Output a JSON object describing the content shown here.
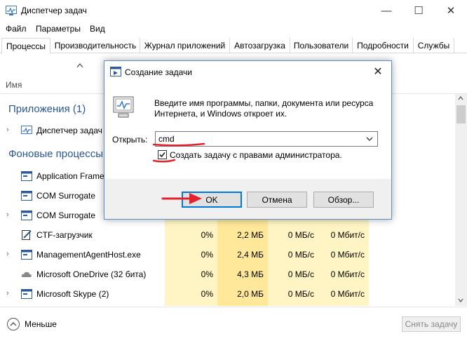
{
  "task_manager": {
    "title": "Диспетчер задач",
    "window_controls": {
      "minimize": "—",
      "maximize": "☐",
      "close": "✕"
    },
    "menu": [
      "Файл",
      "Параметры",
      "Вид"
    ],
    "tabs": [
      "Процессы",
      "Производительность",
      "Журнал приложений",
      "Автозагрузка",
      "Пользователи",
      "Подробности",
      "Службы"
    ],
    "active_tab": "Процессы",
    "column_name": "Имя",
    "sections": {
      "apps": "Приложения (1)",
      "background": "Фоновые процессы"
    },
    "rows": [
      {
        "expand": "›",
        "name": "Диспетчер задач",
        "cpu": "",
        "mem": "",
        "disk": "",
        "net": ""
      },
      {
        "expand": "",
        "name": "Application Frame",
        "cpu": "",
        "mem": "",
        "disk": "",
        "net": ""
      },
      {
        "expand": "",
        "name": "COM Surrogate",
        "cpu": "",
        "mem": "",
        "disk": "",
        "net": ""
      },
      {
        "expand": "›",
        "name": "COM Surrogate",
        "cpu": "",
        "mem": "",
        "disk": "",
        "net": ""
      },
      {
        "expand": "",
        "name": "CTF-загрузчик",
        "cpu": "0%",
        "mem": "2,2 МБ",
        "disk": "0 МБ/с",
        "net": "0 Мбит/с"
      },
      {
        "expand": "›",
        "name": "ManagementAgentHost.exe",
        "cpu": "0%",
        "mem": "2,4 МБ",
        "disk": "0 МБ/с",
        "net": "0 Мбит/с"
      },
      {
        "expand": "",
        "name": "Microsoft OneDrive (32 бита)",
        "cpu": "0%",
        "mem": "4,3 МБ",
        "disk": "0 МБ/с",
        "net": "0 Мбит/с"
      },
      {
        "expand": "›",
        "name": "Microsoft Skype (2)",
        "cpu": "0%",
        "mem": "2,0 МБ",
        "disk": "0 МБ/с",
        "net": "0 Мбит/с"
      }
    ],
    "footer": {
      "less_details": "Меньше",
      "end_task": "Снять задачу"
    }
  },
  "run_dialog": {
    "title": "Создание задачи",
    "close": "✕",
    "description_line1": "Введите имя программы, папки, документа или ресурса",
    "description_line2": "Интернета, и Windows откроет их.",
    "open_label": "Открыть:",
    "open_value": "cmd",
    "admin_checkbox_label": "Создать задачу с правами администратора.",
    "admin_checked": true,
    "ok_label": "OK",
    "cancel_label": "Отмена",
    "browse_label": "Обзор..."
  },
  "colors": {
    "accent_blue": "#2b5797",
    "annotation_red": "#e3232c",
    "cpu_heat": "#fff4c4",
    "mem_heat": "#ffe89a",
    "focus_border": "#0078d7"
  },
  "icons": {
    "app": "task-manager-icon",
    "run": "run-dialog-icon",
    "big": "computer-run-icon"
  }
}
